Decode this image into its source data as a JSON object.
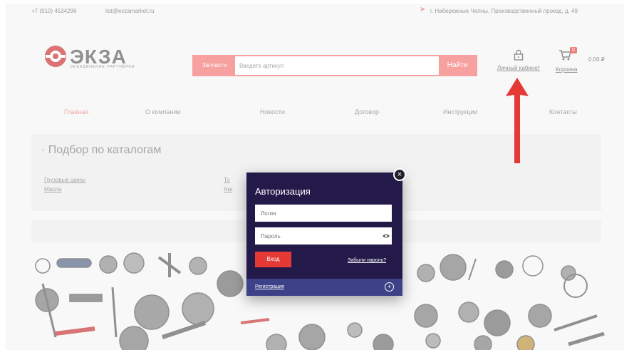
{
  "topbar": {
    "phone": "+7 (910) 4534296",
    "email": "list@exzamarket.ru",
    "address": "г. Набережные Челны, Производственный проезд, д. 49"
  },
  "header": {
    "logo_text": "ЭКЗА",
    "logo_subtitle": "ОБЪЕДИНЕНИЕ ПАРТНЁРОВ",
    "search_category": "Запчасти",
    "search_placeholder": "Введите артикул",
    "search_button": "Найти",
    "account_label": "Личный кабинет",
    "cart_label": "Корзина",
    "cart_count": "0",
    "cart_total": "0.00 ₽"
  },
  "nav": [
    "Главная",
    "О компании",
    "Новости",
    "Договор",
    "Инструкции",
    "Контакты"
  ],
  "catalog": {
    "title": "· Подбор по каталогам",
    "links_col1": [
      "Грузовые шины",
      "Масла"
    ],
    "links_col2": [
      "То",
      "Акк"
    ]
  },
  "modal": {
    "title": "Авторизация",
    "login_placeholder": "Логин",
    "password_placeholder": "Пароль",
    "login_button": "Вход",
    "forgot_link": "Забыли пароль?",
    "register_link": "Регистрация"
  },
  "colors": {
    "accent": "#f26d6d",
    "modal_bg": "#241a4a",
    "register_bar": "#3d4288",
    "arrow": "#e53935"
  }
}
